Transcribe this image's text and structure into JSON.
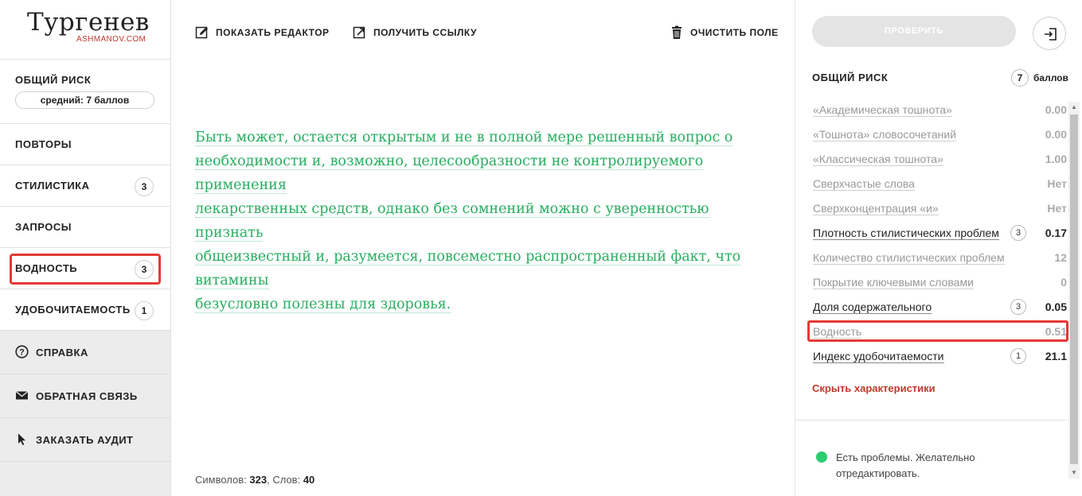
{
  "logo": {
    "title": "Тургенев",
    "subtitle": "ASHMANOV.COM"
  },
  "sidebar": {
    "risk_label": "ОБЩИЙ РИСК",
    "risk_value": "средний: 7 баллов",
    "items": [
      {
        "label": "ПОВТОРЫ",
        "count": ""
      },
      {
        "label": "СТИЛИСТИКА",
        "count": "3"
      },
      {
        "label": "ЗАПРОСЫ",
        "count": ""
      },
      {
        "label": "ВОДНОСТЬ",
        "count": "3"
      },
      {
        "label": "УДОБОЧИТАЕМОСТЬ",
        "count": "1"
      }
    ],
    "secondary": [
      {
        "label": "СПРАВКА",
        "icon": "help-circle-icon"
      },
      {
        "label": "ОБРАТНАЯ СВЯЗЬ",
        "icon": "envelope-icon"
      },
      {
        "label": "ЗАКАЗАТЬ АУДИТ",
        "icon": "cursor-icon"
      }
    ]
  },
  "toolbar": {
    "show_editor": "ПОКАЗАТЬ РЕДАКТОР",
    "get_link": "ПОЛУЧИТЬ ССЫЛКУ",
    "clear": "ОЧИСТИТЬ ПОЛЕ"
  },
  "editor": {
    "lines": [
      "Быть может, остается открытым и не в полной мере решенный вопрос о",
      "необходимости и, возможно, целесообразности не контролируемого применения",
      "лекарственных средств, однако без сомнений можно с уверенностью признать",
      "общеизвестный и, разумеется, повсеместно распространенный факт, что витамины",
      "безусловно полезны для здоровья."
    ],
    "text_color": "#27ae60"
  },
  "counter": {
    "chars_label": "Символов:",
    "chars": "323",
    "words_label": ", Слов:",
    "words": "40"
  },
  "right": {
    "check_button": "ПРОВЕРИТЬ",
    "title": "ОБЩИЙ РИСК",
    "score": "7",
    "score_unit": "баллов",
    "metrics": [
      {
        "name": "«Академическая тошнота»",
        "value": "0.00",
        "badge": "",
        "dark": false
      },
      {
        "name": "«Тошнота» словосочетаний",
        "value": "0.00",
        "badge": "",
        "dark": false
      },
      {
        "name": "«Классическая тошнота»",
        "value": "1.00",
        "badge": "",
        "dark": false
      },
      {
        "name": "Сверхчастые слова",
        "value": "Нет",
        "badge": "",
        "dark": false
      },
      {
        "name": "Сверхконцентрация «и»",
        "value": "Нет",
        "badge": "",
        "dark": false
      },
      {
        "name": "Плотность стилистических проблем",
        "value": "0.17",
        "badge": "3",
        "dark": true
      },
      {
        "name": "Количество стилистических проблем",
        "value": "12",
        "badge": "",
        "dark": false
      },
      {
        "name": "Покрытие ключевыми словами",
        "value": "0",
        "badge": "",
        "dark": false
      },
      {
        "name": "Доля содержательного",
        "value": "0.05",
        "badge": "3",
        "dark": true
      },
      {
        "name": "Водность",
        "value": "0.51",
        "badge": "",
        "dark": false
      },
      {
        "name": "Индекс удобочитаемости",
        "value": "21.1",
        "badge": "1",
        "dark": true
      }
    ],
    "hide_link": "Скрыть характеристики",
    "status": "Есть проблемы. Желательно отредактировать.",
    "status_color": "#2ecc71",
    "accent": "#c0392b",
    "highlight_color": "#e53935"
  }
}
